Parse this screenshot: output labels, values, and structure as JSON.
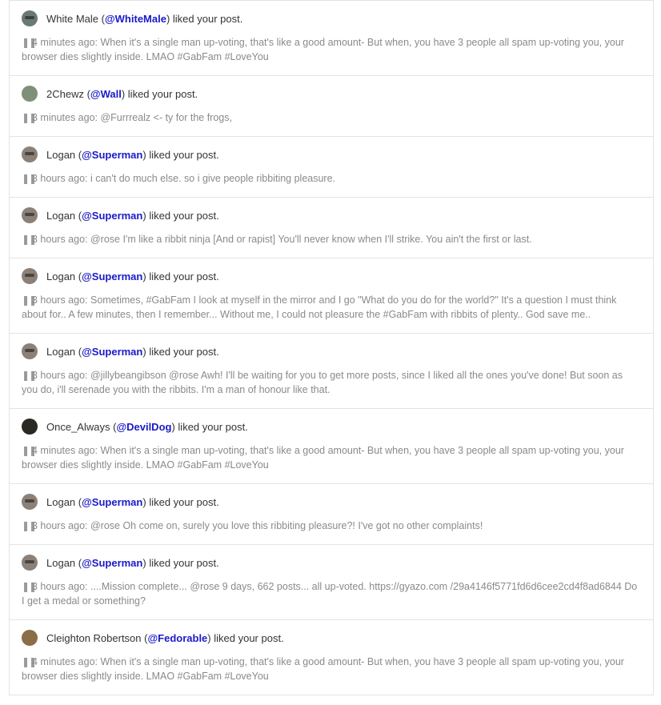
{
  "liked_suffix": "liked your post.",
  "quote_icon": "quote-icon",
  "notifications": [
    {
      "name": "White Male",
      "handle": "@WhiteMale",
      "avatar_color": "#6a7a72",
      "time": "4 minutes ago:",
      "text": "When it's a single man up-voting, that's like a good amount- But when, you have 3 people all spam up-voting you, your browser dies slightly inside. LMAO #GabFam #LoveYou"
    },
    {
      "name": "2Chewz",
      "handle": "@Wall",
      "avatar_color": "#7f8f78",
      "time": "3 minutes ago:",
      "text": "@Furrrealz <- ty for the frogs,"
    },
    {
      "name": "Logan",
      "handle": "@Superman",
      "avatar_color": "#8c8178",
      "time": "3 hours ago:",
      "text": "i can't do much else. so i give people ribbiting pleasure."
    },
    {
      "name": "Logan",
      "handle": "@Superman",
      "avatar_color": "#8c8178",
      "time": "3 hours ago:",
      "text": "@rose I'm like a ribbit ninja [And or rapist] You'll never know when I'll strike. You ain't the first or last."
    },
    {
      "name": "Logan",
      "handle": "@Superman",
      "avatar_color": "#8c8178",
      "time": "3 hours ago:",
      "text": "Sometimes, #GabFam I look at myself in the mirror and I go \"What do you do for the world?\" It's a question I must think about for.. A few minutes, then I remember... Without me, I could not pleasure the #GabFam with ribbits of plenty.. God save me.."
    },
    {
      "name": "Logan",
      "handle": "@Superman",
      "avatar_color": "#8c8178",
      "time": "3 hours ago:",
      "text": "@jillybeangibson @rose Awh! I'll be waiting for you to get more posts, since I liked all the ones you've done! But soon as you do, i'll serenade you with the ribbits. I'm a man of honour like that."
    },
    {
      "name": "Once_Always",
      "handle": "@DevilDog",
      "avatar_color": "#2a2a22",
      "time": "4 minutes ago:",
      "text": "When it's a single man up-voting, that's like a good amount- But when, you have 3 people all spam up-voting you, your browser dies slightly inside. LMAO #GabFam #LoveYou"
    },
    {
      "name": "Logan",
      "handle": "@Superman",
      "avatar_color": "#8c8178",
      "time": "3 hours ago:",
      "text": "@rose Oh come on, surely you love this ribbiting pleasure?! I've got no other complaints!"
    },
    {
      "name": "Logan",
      "handle": "@Superman",
      "avatar_color": "#8c8178",
      "time": "3 hours ago:",
      "text": "....Mission complete... @rose 9 days, 662 posts... all up-voted. https://gyazo.com /29a4146f5771fd6d6cee2cd4f8ad6844 Do I get a medal or something?"
    },
    {
      "name": "Cleighton Robertson",
      "handle": "@Fedorable",
      "avatar_color": "#8a6e48",
      "time": "4 minutes ago:",
      "text": "When it's a single man up-voting, that's like a good amount- But when, you have 3 people all spam up-voting you, your browser dies slightly inside. LMAO #GabFam #LoveYou"
    }
  ]
}
